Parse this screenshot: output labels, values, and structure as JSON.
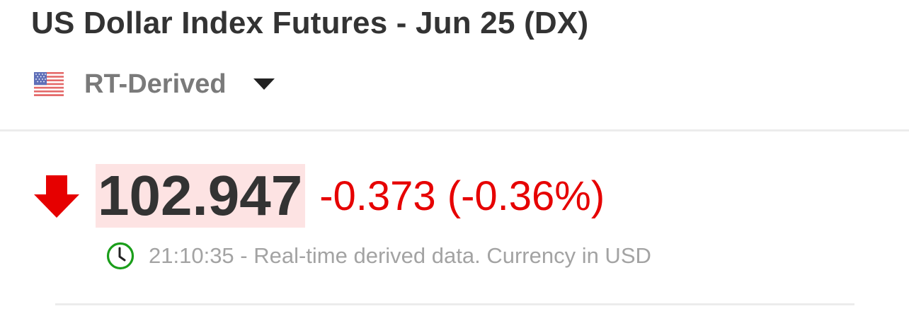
{
  "header": {
    "title": "US Dollar Index Futures - Jun 25 (DX)"
  },
  "source_selector": {
    "flag_icon": "us-flag-icon",
    "label": "RT-Derived",
    "caret_icon": "chevron-down-icon"
  },
  "quote": {
    "direction_icon": "down-arrow-icon",
    "direction_color": "#e60000",
    "last_price": "102.947",
    "highlight_color": "#fde3e3",
    "change_text": "-0.373 (-0.36%)"
  },
  "status": {
    "clock_icon": "clock-icon",
    "clock_color": "#1a9e1a",
    "text": "21:10:35 - Real-time derived data. Currency in USD"
  }
}
